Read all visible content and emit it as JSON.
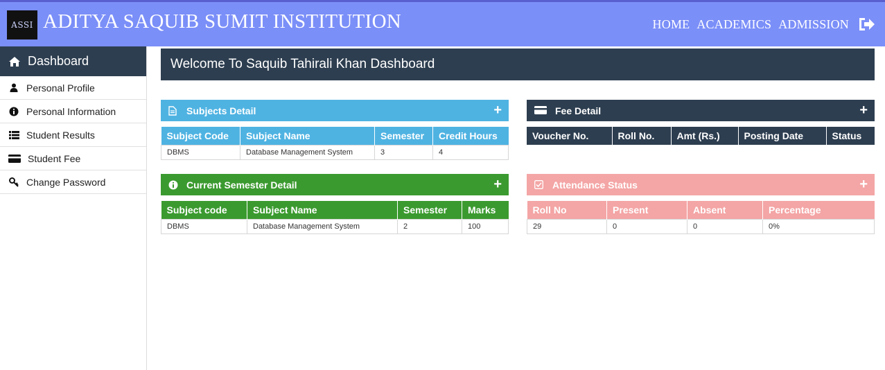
{
  "header": {
    "logo_text": "ASSI",
    "title": "ADITYA SAQUIB SUMIT INSTITUTION",
    "nav": [
      "HOME",
      "ACADEMICS",
      "ADMISSION"
    ],
    "logout_icon": "sign-out-icon",
    "background": "#7b8ff8"
  },
  "sidebar": {
    "title": "Dashboard",
    "title_icon": "home-icon",
    "items": [
      {
        "label": "Personal Profile",
        "icon": "user-icon"
      },
      {
        "label": "Personal Information",
        "icon": "info-circle-icon"
      },
      {
        "label": "Student Results",
        "icon": "list-icon"
      },
      {
        "label": "Student Fee",
        "icon": "credit-card-icon"
      },
      {
        "label": "Change Password",
        "icon": "key-icon"
      }
    ]
  },
  "welcome": "Welcome To Saquib Tahirali Khan Dashboard",
  "subjects": {
    "title": "Subjects Detail",
    "color": "#4fb3e2",
    "columns": [
      "Subject Code",
      "Subject Name",
      "Semester",
      "Credit Hours"
    ],
    "rows": [
      [
        "DBMS",
        "Database Management System",
        "3",
        "4"
      ]
    ]
  },
  "fee": {
    "title": "Fee Detail",
    "color": "#2d3e50",
    "columns": [
      "Voucher No.",
      "Roll No.",
      "Amt (Rs.)",
      "Posting Date",
      "Status"
    ]
  },
  "semester": {
    "title": "Current Semester Detail",
    "color": "#3b9a2f",
    "columns": [
      "Subject code",
      "Subject Name",
      "Semester",
      "Marks"
    ],
    "rows": [
      [
        "DBMS",
        "Database Management System",
        "2",
        "100"
      ]
    ]
  },
  "attendance": {
    "title": "Attendance Status",
    "color": "#f4a5a5",
    "columns": [
      "Roll No",
      "Present",
      "Absent",
      "Percentage"
    ],
    "rows": [
      [
        "29",
        "0",
        "0",
        "0%"
      ]
    ]
  },
  "plus_symbol": "+"
}
